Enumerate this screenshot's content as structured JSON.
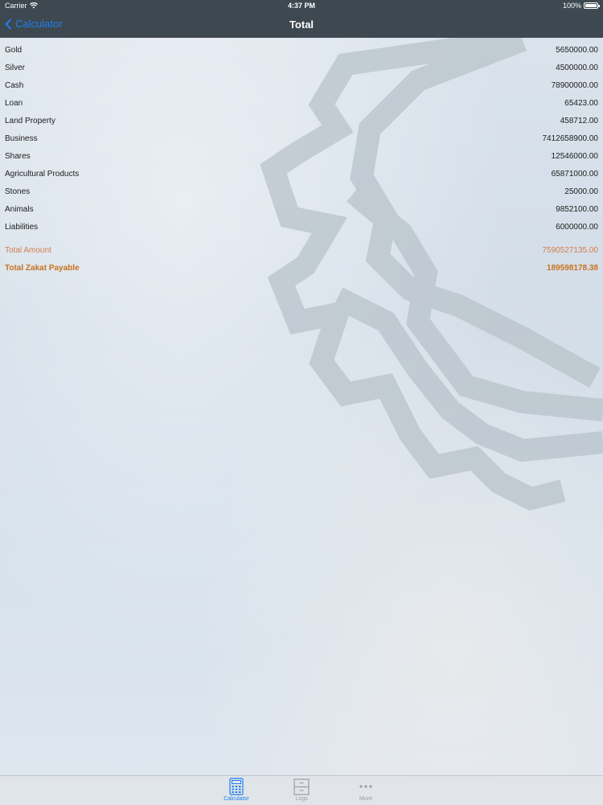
{
  "status_bar": {
    "carrier": "Carrier",
    "time": "4:37 PM",
    "battery": "100%"
  },
  "nav": {
    "back_label": "Calculator",
    "title": "Total"
  },
  "assets": [
    {
      "label": "Gold",
      "value": "5650000.00"
    },
    {
      "label": "Silver",
      "value": "4500000.00"
    },
    {
      "label": "Cash",
      "value": "78900000.00"
    },
    {
      "label": "Loan",
      "value": "65423.00"
    },
    {
      "label": "Land Property",
      "value": "458712.00"
    },
    {
      "label": "Business",
      "value": "7412658900.00"
    },
    {
      "label": "Shares",
      "value": "12546000.00"
    },
    {
      "label": "Agricultural Products",
      "value": "65871000.00"
    },
    {
      "label": "Stones",
      "value": "25000.00"
    },
    {
      "label": "Animals",
      "value": "9852100.00"
    },
    {
      "label": "Liabilities",
      "value": "6000000.00"
    }
  ],
  "summary": {
    "total_amount_label": "Total Amount",
    "total_amount_value": "7590527135.00",
    "zakat_label": "Total Zakat Payable",
    "zakat_value": "189598178.38"
  },
  "tabs": [
    {
      "label": "Calculator",
      "icon": "calculator-icon",
      "selected": true
    },
    {
      "label": "Logs",
      "icon": "cabinet-icon",
      "selected": false
    },
    {
      "label": "More",
      "icon": "more-dots-icon",
      "selected": false
    }
  ],
  "colors": {
    "nav_background": "#3d4850",
    "accent": "#1f7ef0",
    "total_amount": "#d27d4e",
    "zakat": "#c9731f"
  }
}
